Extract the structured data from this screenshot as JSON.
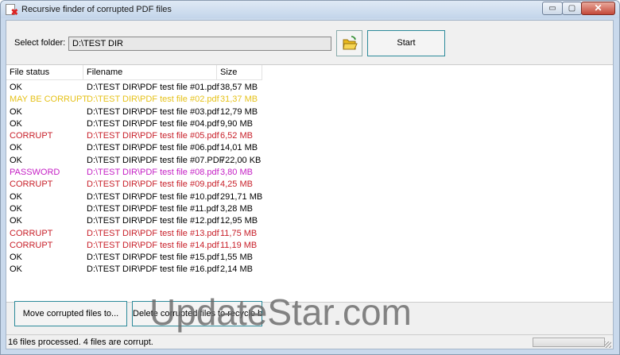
{
  "window": {
    "title": "Recursive finder of corrupted PDF files",
    "min_glyph": "▭",
    "max_glyph": "▢",
    "close_glyph": "✕"
  },
  "folder": {
    "label": "Select folder:",
    "value": "D:\\TEST DIR"
  },
  "buttons": {
    "start": "Start",
    "move": "Move corrupted files to...",
    "delete": "Delete corrupted files to recycle bin"
  },
  "table": {
    "headers": [
      "File status",
      "Filename",
      "Size"
    ],
    "rows": [
      {
        "status": "OK",
        "filename": "D:\\TEST DIR\\PDF test file #01.pdf",
        "size": "38,57 MB",
        "color": "#000000"
      },
      {
        "status": "MAY BE CORRUPT",
        "filename": "D:\\TEST DIR\\PDF test file #02.pdf",
        "size": "31,37 MB",
        "color": "#e6c21a"
      },
      {
        "status": "OK",
        "filename": "D:\\TEST DIR\\PDF test file #03.pdf",
        "size": "12,79 MB",
        "color": "#000000"
      },
      {
        "status": "OK",
        "filename": "D:\\TEST DIR\\PDF test file #04.pdf",
        "size": "9,90 MB",
        "color": "#000000"
      },
      {
        "status": "CORRUPT",
        "filename": "D:\\TEST DIR\\PDF test file #05.pdf",
        "size": "6,52 MB",
        "color": "#c8202a"
      },
      {
        "status": "OK",
        "filename": "D:\\TEST DIR\\PDF test file #06.pdf",
        "size": "14,01 MB",
        "color": "#000000"
      },
      {
        "status": "OK",
        "filename": "D:\\TEST DIR\\PDF test file #07.PDF",
        "size": "722,00 KB",
        "color": "#000000"
      },
      {
        "status": "PASSWORD",
        "filename": "D:\\TEST DIR\\PDF test file #08.pdf",
        "size": "3,80 MB",
        "color": "#c51fc5"
      },
      {
        "status": "CORRUPT",
        "filename": "D:\\TEST DIR\\PDF test file #09.pdf",
        "size": "4,25 MB",
        "color": "#c8202a"
      },
      {
        "status": "OK",
        "filename": "D:\\TEST DIR\\PDF test file #10.pdf",
        "size": "291,71 MB",
        "color": "#000000"
      },
      {
        "status": "OK",
        "filename": "D:\\TEST DIR\\PDF test file #11.pdf",
        "size": "3,28 MB",
        "color": "#000000"
      },
      {
        "status": "OK",
        "filename": "D:\\TEST DIR\\PDF test file #12.pdf",
        "size": "12,95 MB",
        "color": "#000000"
      },
      {
        "status": "CORRUPT",
        "filename": "D:\\TEST DIR\\PDF test file #13.pdf",
        "size": "11,75 MB",
        "color": "#c8202a"
      },
      {
        "status": "CORRUPT",
        "filename": "D:\\TEST DIR\\PDF test file #14.pdf",
        "size": "11,19 MB",
        "color": "#c8202a"
      },
      {
        "status": "OK",
        "filename": "D:\\TEST DIR\\PDF test file #15.pdf",
        "size": "1,55 MB",
        "color": "#000000"
      },
      {
        "status": "OK",
        "filename": "D:\\TEST DIR\\PDF test file #16.pdf",
        "size": "2,14 MB",
        "color": "#000000"
      }
    ]
  },
  "status": {
    "text": "16 files processed. 4 files are corrupt."
  },
  "watermark": "UpdateStar.com",
  "icons": {
    "folder": "folder-open-icon",
    "app": "pdf-error-icon"
  }
}
